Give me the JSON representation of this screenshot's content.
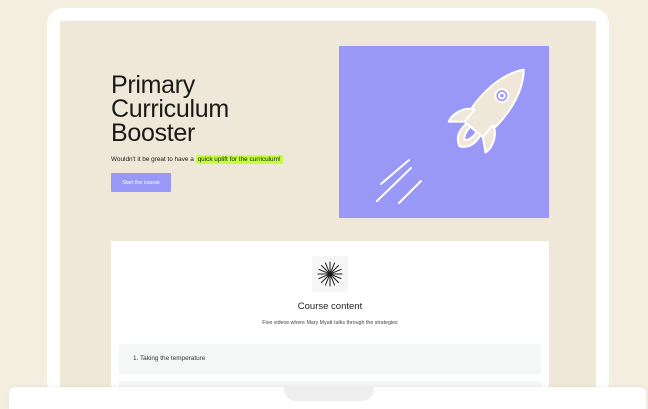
{
  "hero": {
    "title_lines": [
      "Primary",
      "Curriculum",
      "Booster"
    ],
    "tagline_prefix": "Wouldn't it be great to have a ",
    "tagline_highlight": "quick uplift for the curriculum!",
    "cta_label": "Start the course",
    "image_icon": "rocket-icon"
  },
  "course": {
    "icon": "burst-icon",
    "title": "Course content",
    "subtitle": "Five videos where Mary Myatt talks through the strategies",
    "lessons": [
      "1. Taking the temperature",
      ""
    ]
  },
  "colors": {
    "background": "#f3eee0",
    "screen": "#efe7d7",
    "accent_purple": "#9a98f7",
    "highlight_lime": "#c6ff3d",
    "rocket_fill": "#efe7d7"
  }
}
